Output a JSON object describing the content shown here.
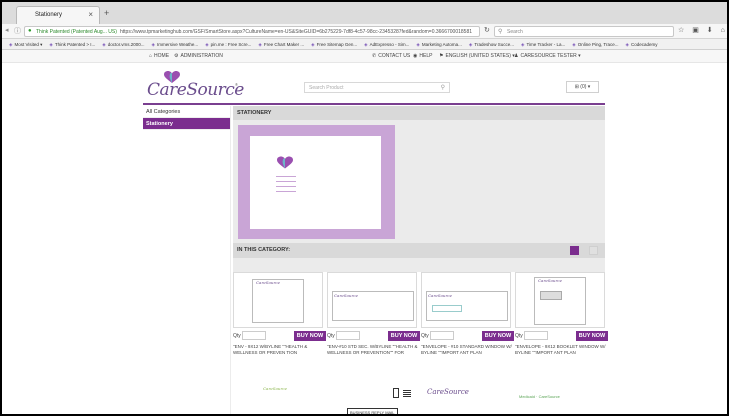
{
  "browser": {
    "tab_title": "Stationery",
    "tab_close": "×",
    "new_tab": "+",
    "url_site": "Think Patented (Patented Aug... US)",
    "url_text": "https://www.tpmarketinghub.com/GSF/SmartStore.aspx?CultureName=en-US&SiteGUID=6b275229-7df8-4c57-98cc-23453287fed&random=0.3666700018581",
    "search_placeholder": "Search",
    "bookmarks": [
      "Most Visited ▾",
      "Think Patented > I...",
      "doctor.vms.2000...",
      "Immersive Weathe...",
      "pin.me : Free Scre...",
      "Free Chart Maker ...",
      "Free Sitemap Gen...",
      "AdExpresso - Sim...",
      "Marketing Automa...",
      "Tradeshow Succe...",
      "Time Tracker - La...",
      "Online Ping, Trace...",
      "Codecademy"
    ]
  },
  "site_top": {
    "home": "HOME",
    "administration": "ADMINISTRATION",
    "contact": "CONTACT US",
    "help": "HELP",
    "language": "ENGLISH (UNITED STATES) ▾",
    "account": "CARESOURCE TESTER ▾"
  },
  "header": {
    "logo_text": "CareSource",
    "logo_tm": "®",
    "search_placeholder": "Search Product",
    "cart_label": "(0) ▾"
  },
  "sidebar": {
    "items": [
      {
        "label": "All Categories"
      },
      {
        "label": "Stationery"
      }
    ]
  },
  "main": {
    "title": "STATIONERY",
    "in_category": "IN THIS CATEGORY:"
  },
  "products": [
    {
      "name": "\"ENV - 9X12 W/BYLINE \"\"HEALTH & WELLNESS OR PREVEN TION",
      "qty_label": "Qty",
      "buy_label": "BUY NOW"
    },
    {
      "name": "\"ENV-#10 STD SEC. W/BYLINE \"\"HEALTH & WELLNESS OR PREVENTION\"\" FOR",
      "qty_label": "Qty",
      "buy_label": "BUY NOW"
    },
    {
      "name": "\"ENVELOPE - #10 STANDARD WINDOW W/ BYLINE \"\"IMPORT ANT PLAN",
      "qty_label": "Qty",
      "buy_label": "BUY NOW"
    },
    {
      "name": "\"ENVELOPE - 9X12 BOOKLET WINDOW W/ BYLINE \"\"IMPORT ANT PLAN",
      "qty_label": "Qty",
      "buy_label": "BUY NOW"
    }
  ],
  "second_row": {
    "card2_text": "BUSINESS REPLY MAIL",
    "card3_logo": "CareSource",
    "card4_text": "Medicaid · CareSource"
  },
  "colors": {
    "brand_purple": "#7b2d8e",
    "hero_lilac": "#c9a5d6"
  },
  "icons": [
    "lock-icon",
    "reload-icon",
    "search-icon",
    "home-icon",
    "gear-icon",
    "phone-icon",
    "help-icon",
    "flag-icon",
    "user-icon",
    "cart-icon",
    "grid-view-icon",
    "list-view-icon"
  ]
}
